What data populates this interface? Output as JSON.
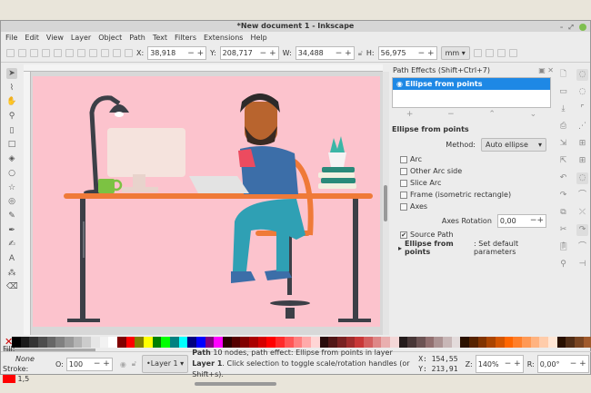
{
  "window": {
    "title": "*New document 1 - Inkscape"
  },
  "menu": [
    "File",
    "Edit",
    "View",
    "Layer",
    "Object",
    "Path",
    "Text",
    "Filters",
    "Extensions",
    "Help"
  ],
  "toolbar": {
    "x_label": "X:",
    "x": "38,918",
    "y_label": "Y:",
    "y": "208,717",
    "w_label": "W:",
    "w": "34,488",
    "h_label": "H:",
    "h": "56,975",
    "unit": "mm"
  },
  "panel": {
    "title": "Path Effects  (Shift+Ctrl+7)",
    "effects": [
      "Ellipse from points"
    ],
    "section": "Ellipse from points",
    "method_label": "Method:",
    "method": "Auto ellipse",
    "options": [
      {
        "label": "Arc",
        "checked": false
      },
      {
        "label": "Other Arc side",
        "checked": false
      },
      {
        "label": "Slice Arc",
        "checked": false
      },
      {
        "label": "Frame (isometric rectangle)",
        "checked": false
      },
      {
        "label": "Axes",
        "checked": false
      }
    ],
    "axes_rotation_label": "Axes Rotation",
    "axes_rotation": "0,00",
    "source_path": "Source Path",
    "defaults_bold": "Ellipse from points",
    "defaults_rest": ": Set default parameters"
  },
  "status": {
    "fill_label": "Fill:",
    "fill": "None",
    "stroke_label": "Stroke:",
    "stroke_width": "1,5",
    "stroke_color": "#ff0000",
    "opacity_label": "O:",
    "opacity": "100",
    "layer": "•Layer 1",
    "msg_b1": "Path",
    "msg_1": " 10 nodes, path effect: Ellipse from points in layer ",
    "msg_b2": "Layer 1",
    "msg_2": ". Click selection to toggle scale/rotation handles (or Shift+s).",
    "cx": "154,55",
    "cy": "213,91",
    "zoom_label": "Z:",
    "zoom": "140%",
    "rot_label": "R:",
    "rotation": "0,00°"
  },
  "palette": [
    "#000000",
    "#1a1a1a",
    "#333333",
    "#4d4d4d",
    "#666666",
    "#808080",
    "#999999",
    "#b3b3b3",
    "#cccccc",
    "#e6e6e6",
    "#f2f2f2",
    "#ffffff",
    "#800000",
    "#ff0000",
    "#808000",
    "#ffff00",
    "#008000",
    "#00ff00",
    "#008080",
    "#00ffff",
    "#000080",
    "#0000ff",
    "#800080",
    "#ff00ff",
    "#2b0000",
    "#550000",
    "#800000",
    "#aa0000",
    "#d40000",
    "#ff0000",
    "#ff2a2a",
    "#ff5555",
    "#ff8080",
    "#ffaaaa",
    "#ffd5d5",
    "#280b0b",
    "#501616",
    "#782121",
    "#a02c2c",
    "#c83737",
    "#d35f5f",
    "#de8787",
    "#e9afaf",
    "#f4d7d7",
    "#241c1c",
    "#483737",
    "#6c5353",
    "#916f6f",
    "#ac9393",
    "#c8b7b7",
    "#e3dbdb",
    "#2b1100",
    "#552200",
    "#803300",
    "#aa4400",
    "#d45500",
    "#ff6600",
    "#ff7f2a",
    "#ff9955",
    "#ffb380",
    "#ffccaa",
    "#ffe6d5",
    "#281000",
    "#502d16",
    "#784421",
    "#a05a2c"
  ]
}
